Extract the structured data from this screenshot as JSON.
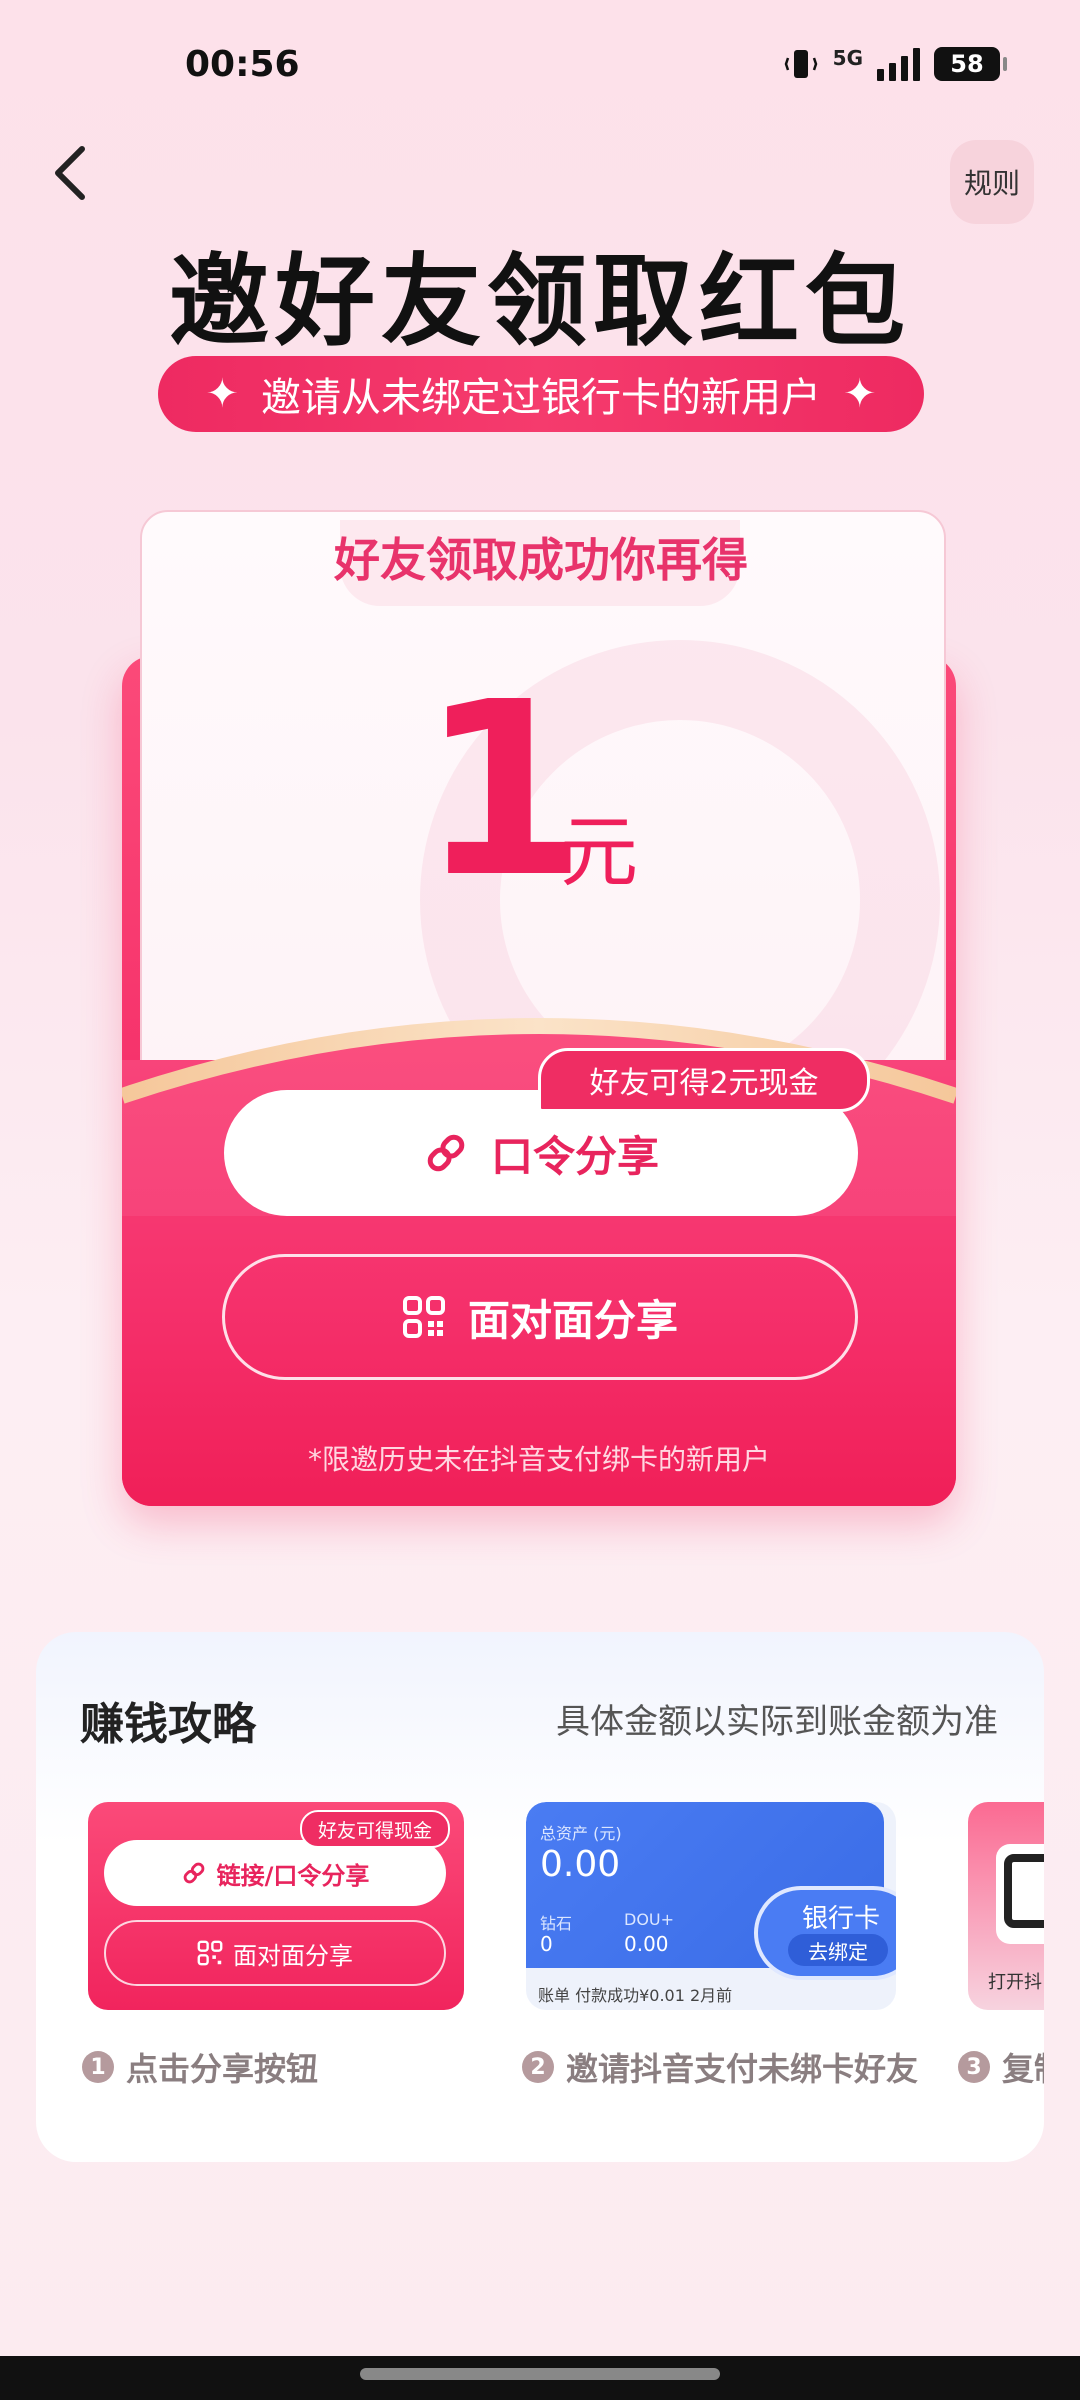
{
  "status": {
    "time": "00:56",
    "network": "5G",
    "battery": "58"
  },
  "header": {
    "rules_label": "规则"
  },
  "hero": {
    "title": "邀好友领取红包",
    "subtitle": "邀请从未绑定过银行卡的新用户"
  },
  "packet": {
    "head": "好友领取成功你再得",
    "amount": "1",
    "unit": "元",
    "bonus_tag": "好友可得2元现金",
    "code_share_label": "口令分享",
    "face_share_label": "面对面分享",
    "note": "*限邀历史未在抖音支付绑卡的新用户"
  },
  "strategy": {
    "title": "赚钱攻略",
    "note": "具体金额以实际到账金额为准",
    "card1": {
      "tag": "好友可得现金",
      "btn1": "链接/口令分享",
      "btn2": "面对面分享"
    },
    "card2": {
      "label": "总资产 (元)",
      "amount": "0.00",
      "s1_label": "钻石",
      "s1_value": "0",
      "s2_label": "DOU+",
      "s2_value": "0.00",
      "footer": "账单  付款成功¥0.01  2月前",
      "bank_title": "银行卡",
      "bank_action": "去绑定"
    },
    "card3": {
      "label": "打开抖"
    },
    "steps": [
      {
        "num": "1",
        "label": "点击分享按钮"
      },
      {
        "num": "2",
        "label": "邀请抖音支付未绑卡好友"
      },
      {
        "num": "3",
        "label": "复制"
      }
    ]
  }
}
